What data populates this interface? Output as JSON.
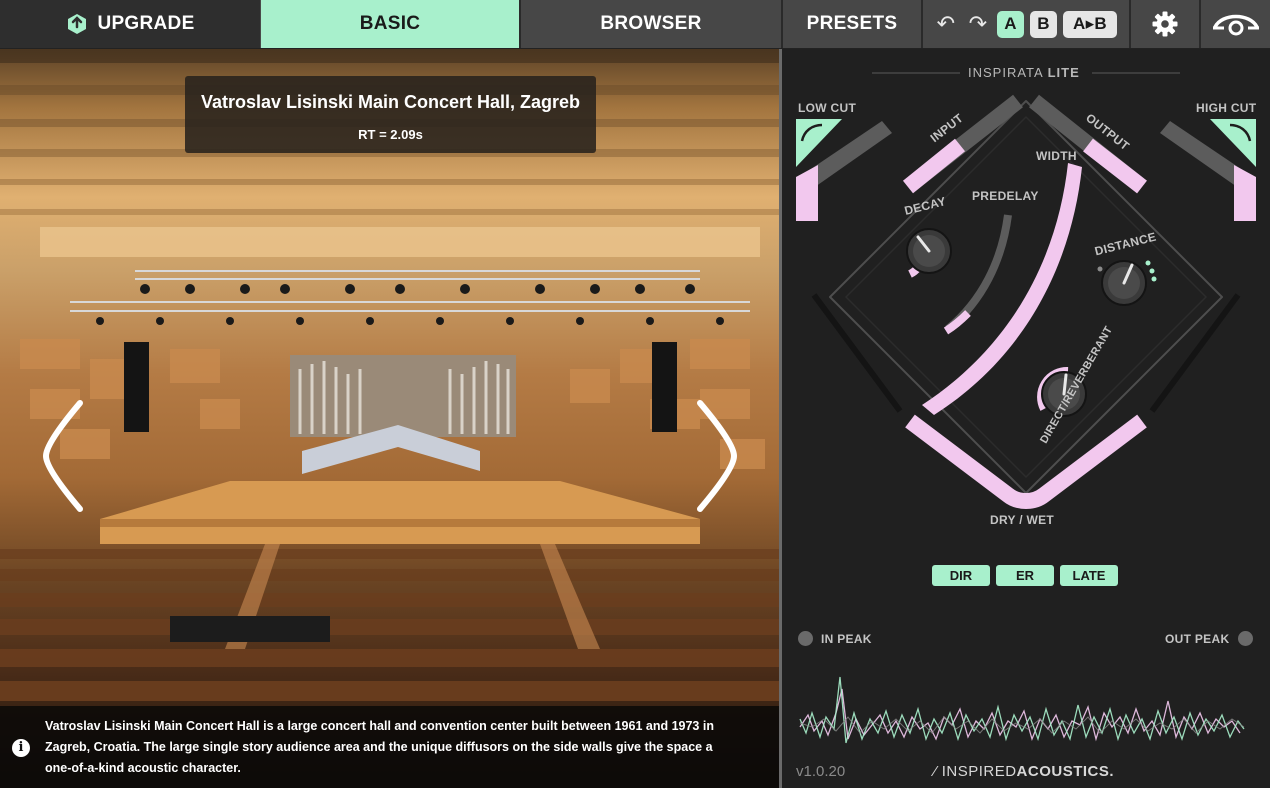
{
  "topbar": {
    "upgrade_label": "UPGRADE",
    "basic_label": "BASIC",
    "browser_label": "BROWSER",
    "presets_label": "PRESETS",
    "a_label": "A",
    "b_label": "B",
    "atob_label": "A▸B"
  },
  "hall": {
    "name": "Vatroslav Lisinski Main Concert Hall, Zagreb",
    "rt": "RT = 2.09s",
    "description_line1": "Vatroslav Lisinski Main Concert Hall is a large concert hall and convention center built between 1961 and 1973 in",
    "description_line2": "Zagreb, Croatia. The large single story audience area and the unique diffusors on the side walls give the space a",
    "description_line3": "one-of-a-kind acoustic character."
  },
  "plugin": {
    "product_name": "INSPIRATA",
    "product_edition": "LITE",
    "low_cut": "LOW CUT",
    "high_cut": "HIGH CUT",
    "input": "INPUT",
    "output": "OUTPUT",
    "width": "WIDTH",
    "predelay": "PREDELAY",
    "decay": "DECAY",
    "distance": "DISTANCE",
    "direct_reverberant": "DIRECT/REVERBERANT",
    "dry_wet": "DRY / WET",
    "modes": [
      "DIR",
      "ER",
      "LATE"
    ],
    "in_peak": "IN PEAK",
    "out_peak": "OUT PEAK",
    "version": "v1.0.20",
    "brand_light": "INSPIRED",
    "brand_bold": "ACOUSTICS."
  },
  "colors": {
    "accent_mint": "#a8f0cc",
    "accent_pink": "#f2c8ee",
    "panel_bg": "#202020",
    "track_gray": "#5c5c5c"
  },
  "icons": [
    "upgrade-box-icon",
    "undo-icon",
    "redo-icon",
    "gear-icon",
    "inspired-acoustics-logo-icon",
    "info-icon",
    "chevron-left-icon",
    "chevron-right-icon"
  ]
}
